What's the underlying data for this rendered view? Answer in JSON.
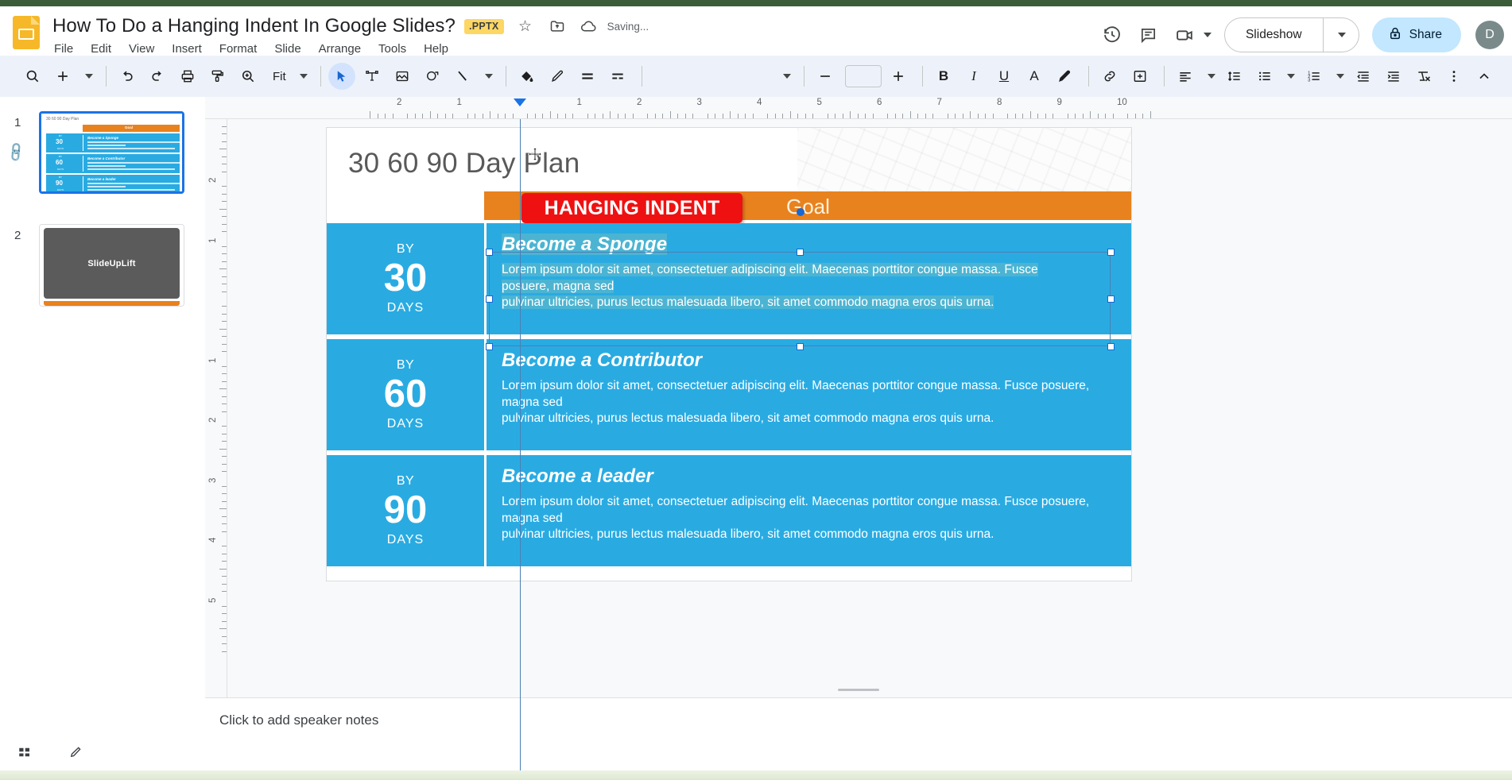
{
  "header": {
    "doc_title": "How To Do a Hanging Indent In Google Slides?",
    "file_badge": ".PPTX",
    "star_icon": "star-icon",
    "move_icon": "move-to-folder-icon",
    "cloud_icon": "cloud-status-icon",
    "saving_status": "Saving...",
    "menu": [
      "File",
      "Edit",
      "View",
      "Insert",
      "Format",
      "Slide",
      "Arrange",
      "Tools",
      "Help"
    ],
    "history_icon": "version-history-icon",
    "comment_icon": "comment-icon",
    "meet_icon": "video-camera-icon",
    "slideshow_label": "Slideshow",
    "share_label": "Share",
    "lock_icon": "lock-icon",
    "avatar_initial": "D"
  },
  "toolbar": {
    "search_icon": "search-icon",
    "new_slide_icon": "plus-icon",
    "undo_icon": "undo-icon",
    "redo_icon": "redo-icon",
    "print_icon": "print-icon",
    "paint_format_icon": "paint-format-icon",
    "zoom_icon": "zoom-in-icon",
    "zoom_value": "Fit",
    "select_icon": "cursor-arrow-icon",
    "textbox_icon": "text-box-icon",
    "image_icon": "insert-image-icon",
    "shape_icon": "shape-icon",
    "line_icon": "line-icon",
    "fill_icon": "fill-color-icon",
    "border_color_icon": "border-color-icon",
    "border_weight_icon": "border-weight-icon",
    "border_dash_icon": "border-dash-icon",
    "font_size_value": "",
    "decrease_font_icon": "minus-icon",
    "increase_font_icon": "plus-icon",
    "bold_label": "B",
    "italic_label": "I",
    "underline_label": "U",
    "text_color_label": "A",
    "highlight_icon": "highlight-pen-icon",
    "link_icon": "insert-link-icon",
    "comment_add_icon": "add-comment-icon",
    "align_icon": "align-left-icon",
    "line_spacing_icon": "line-spacing-icon",
    "bulleted_list_icon": "bulleted-list-icon",
    "numbered_list_icon": "numbered-list-icon",
    "decrease_indent_icon": "decrease-indent-icon",
    "increase_indent_icon": "increase-indent-icon",
    "clear_format_icon": "clear-formatting-icon",
    "more_icon": "more-options-icon",
    "collapse_icon": "collapse-toolbar-icon"
  },
  "filmstrip": {
    "slides": [
      {
        "number": "1",
        "title": "30 60 90 Day Plan",
        "goal": "Goal",
        "rows": [
          {
            "by": "BY",
            "num": "30",
            "days": "DAYS",
            "heading": "Become a Sponge"
          },
          {
            "by": "BY",
            "num": "60",
            "days": "DAYS",
            "heading": "Become a Contributor"
          },
          {
            "by": "BY",
            "num": "90",
            "days": "DAYS",
            "heading": "Become a leader"
          }
        ]
      },
      {
        "number": "2",
        "watermark": "SlideUpLift"
      }
    ],
    "link_icon": "link-chain-icon"
  },
  "ruler": {
    "horizontal_labels": [
      "2",
      "1",
      "1",
      "2",
      "3",
      "4",
      "5",
      "6",
      "7",
      "8",
      "9",
      "10"
    ],
    "vertical_labels": [
      "1",
      "1",
      "2",
      "3",
      "4",
      "5"
    ],
    "indent_marker": "hanging-indent-marker"
  },
  "slide": {
    "title": "30 60 90 Day Plan",
    "goal_header": "Goal",
    "hanging_indent_badge": "HANGING INDENT",
    "rows": [
      {
        "by": "BY",
        "number": "30",
        "days": "DAYS",
        "heading": "Become a Sponge",
        "line1": "Lorem ipsum dolor sit amet, consectetuer adipiscing elit. Maecenas porttitor congue massa. Fusce",
        "line2": "posuere, magna sed",
        "line3": "pulvinar ultricies, purus lectus malesuada libero, sit amet commodo magna eros quis urna."
      },
      {
        "by": "BY",
        "number": "60",
        "days": "DAYS",
        "heading": "Become a Contributor",
        "line1": "Lorem ipsum dolor sit amet, consectetuer adipiscing elit. Maecenas porttitor congue massa. Fusce posuere,",
        "line2": "magna sed",
        "line3": "pulvinar ultricies, purus lectus malesuada libero, sit amet commodo magna eros quis urna."
      },
      {
        "by": "BY",
        "number": "90",
        "days": "DAYS",
        "heading": "Become a leader",
        "line1": "Lorem ipsum dolor sit amet, consectetuer adipiscing elit. Maecenas porttitor congue massa. Fusce posuere,",
        "line2": "magna sed",
        "line3": "pulvinar ultricies, purus lectus malesuada libero, sit amet commodo magna eros quis urna."
      }
    ]
  },
  "notes": {
    "placeholder": "Click to add speaker notes"
  },
  "statusbar": {
    "grid_icon": "filmstrip-view-icon",
    "pen_icon": "annotate-pen-icon"
  },
  "colors": {
    "brand_orange": "#e8821e",
    "slide_blue": "#29abe2",
    "badge_red": "#ef1111",
    "accent_blue": "#1a73e8",
    "toolbar_bg": "#edf2fa",
    "share_bg": "#c2e7ff"
  }
}
